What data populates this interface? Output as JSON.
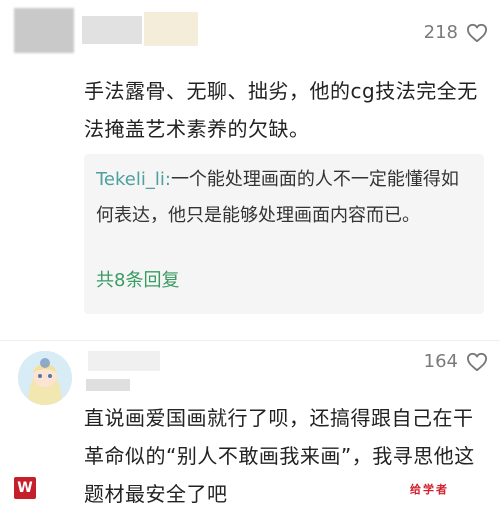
{
  "comments": [
    {
      "likes": "218",
      "text": "手法露骨、无聊、拙劣，他的cg技法完全无法掩盖艺术素养的欠缺。",
      "reply": {
        "user": "Tekeli_li:",
        "text": "一个能处理画面的人不一定能懂得如何表达，他只是能够处理画面内容而已。",
        "more": "共8条回复"
      }
    },
    {
      "likes": "164",
      "text": "直说画爱国画就行了呗，还搞得跟自己在干革命似的“别人不敢画我来画”，我寻思他这题材最安全了吧"
    }
  ],
  "watermarks": {
    "left_logo": "W",
    "right_text": "给学者"
  },
  "icons": {
    "like": "heart-outline-icon"
  },
  "colors": {
    "reply_user": "#4f9f9f",
    "more_replies": "#3a9b64",
    "watermark": "#d3202f"
  }
}
